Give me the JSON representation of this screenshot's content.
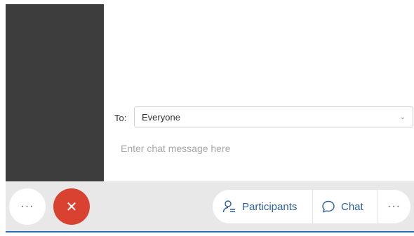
{
  "chat": {
    "to_label": "To:",
    "recipient": "Everyone",
    "message_placeholder": "Enter chat message here"
  },
  "toolbar": {
    "more_label": "···",
    "end_call_glyph": "✕",
    "participants_label": "Participants",
    "chat_label": "Chat",
    "more_right_label": "···"
  },
  "colors": {
    "end_call": "#d94230",
    "accent": "#2c5d9b",
    "toolbar_bg": "#e8e8e8",
    "video_bg": "#3d3d3d"
  },
  "icons": [
    "chevron-down-icon",
    "close-icon",
    "participants-icon",
    "chat-bubble-icon",
    "more-icon"
  ]
}
